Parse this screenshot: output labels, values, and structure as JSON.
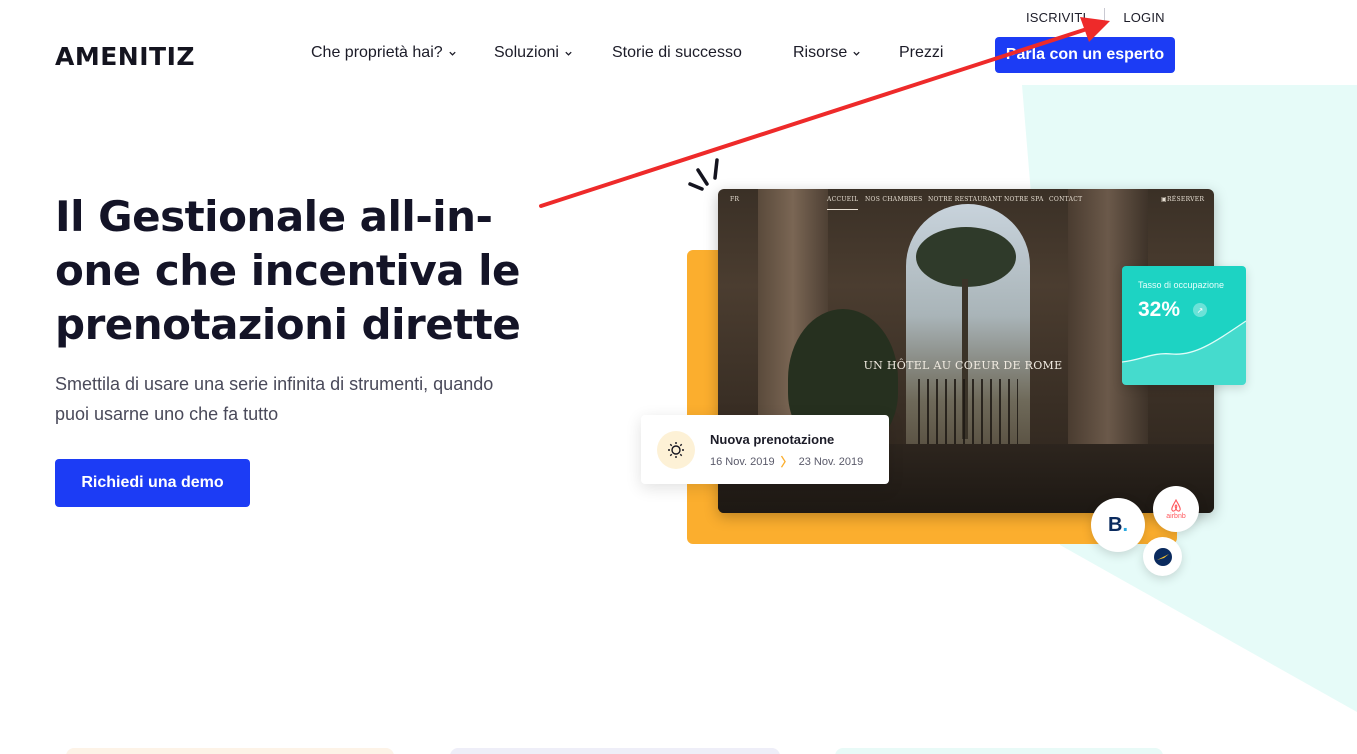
{
  "utility": {
    "signup": "ISCRIVITI",
    "login": "LOGIN"
  },
  "header": {
    "logo": "AMENITIZ",
    "nav": [
      {
        "label": "Che proprietà hai?",
        "dropdown": true
      },
      {
        "label": "Soluzioni",
        "dropdown": true
      },
      {
        "label": "Storie di successo",
        "dropdown": false
      },
      {
        "label": "Risorse",
        "dropdown": true
      },
      {
        "label": "Prezzi",
        "dropdown": false
      }
    ],
    "cta": "Parla con un esperto"
  },
  "hero": {
    "title": "Il Gestionale all-in-one che incentiva le prenotazioni dirette",
    "subtitle": "Smettila di usare una serie infinita di strumenti, quando puoi usarne uno che fa tutto",
    "demo_button": "Richiedi una demo"
  },
  "mockup": {
    "lang": "FR",
    "nav": [
      "ACCUEIL",
      "NOS CHAMBRES",
      "NOTRE RESTAURANT",
      "NOTRE SPA",
      "CONTACT"
    ],
    "reserve": "RÉSERVER",
    "tagline": "UN HÔTEL AU COEUR DE ROME"
  },
  "occupancy": {
    "label": "Tasso di occupazione",
    "value": "32%"
  },
  "booking": {
    "title": "Nuova prenotazione",
    "from": "16 Nov. 2019",
    "to": "23 Nov. 2019"
  },
  "partners": {
    "booking": "B",
    "airbnb": "airbnb"
  },
  "colors": {
    "primary": "#1c3cf5",
    "accent_orange": "#fbae2e",
    "accent_teal": "#1dd3c3",
    "mint_bg": "#e6fbf8",
    "annotation_red": "#ee2a2a"
  }
}
